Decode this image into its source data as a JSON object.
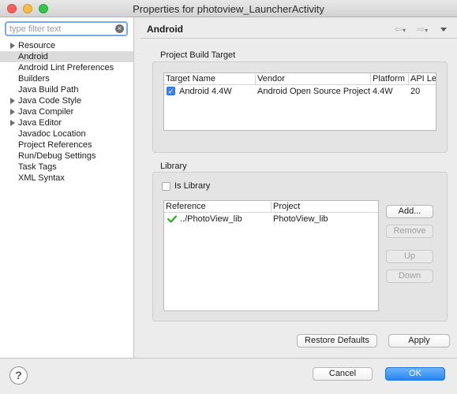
{
  "window": {
    "title": "Properties for photoview_LauncherActivity"
  },
  "filter": {
    "placeholder": "type filter text",
    "value": ""
  },
  "tree": {
    "items": [
      {
        "label": "Resource",
        "expandable": true,
        "selected": false
      },
      {
        "label": "Android",
        "expandable": false,
        "selected": true
      },
      {
        "label": "Android Lint Preferences",
        "expandable": false,
        "selected": false
      },
      {
        "label": "Builders",
        "expandable": false,
        "selected": false
      },
      {
        "label": "Java Build Path",
        "expandable": false,
        "selected": false
      },
      {
        "label": "Java Code Style",
        "expandable": true,
        "selected": false
      },
      {
        "label": "Java Compiler",
        "expandable": true,
        "selected": false
      },
      {
        "label": "Java Editor",
        "expandable": true,
        "selected": false
      },
      {
        "label": "Javadoc Location",
        "expandable": false,
        "selected": false
      },
      {
        "label": "Project References",
        "expandable": false,
        "selected": false
      },
      {
        "label": "Run/Debug Settings",
        "expandable": false,
        "selected": false
      },
      {
        "label": "Task Tags",
        "expandable": false,
        "selected": false
      },
      {
        "label": "XML Syntax",
        "expandable": false,
        "selected": false
      }
    ]
  },
  "page": {
    "title": "Android"
  },
  "build_target": {
    "label": "Project Build Target",
    "columns": [
      "Target Name",
      "Vendor",
      "Platform",
      "API Le"
    ],
    "rows": [
      {
        "checked": true,
        "name": "Android 4.4W",
        "vendor": "Android Open Source Project",
        "platform": "4.4W",
        "api": "20"
      }
    ]
  },
  "library": {
    "label": "Library",
    "is_library_label": "Is Library",
    "is_library_checked": false,
    "columns": [
      "Reference",
      "Project"
    ],
    "rows": [
      {
        "reference": "../PhotoView_lib",
        "project": "PhotoView_lib"
      }
    ],
    "buttons": {
      "add": "Add...",
      "remove": "Remove",
      "up": "Up",
      "down": "Down"
    }
  },
  "actions": {
    "restore_defaults": "Restore Defaults",
    "apply": "Apply",
    "cancel": "Cancel",
    "ok": "OK",
    "help": "?"
  },
  "colors": {
    "accent": "#2686f3",
    "selected_row": "#dcdcdc",
    "check_green": "#35a629"
  }
}
